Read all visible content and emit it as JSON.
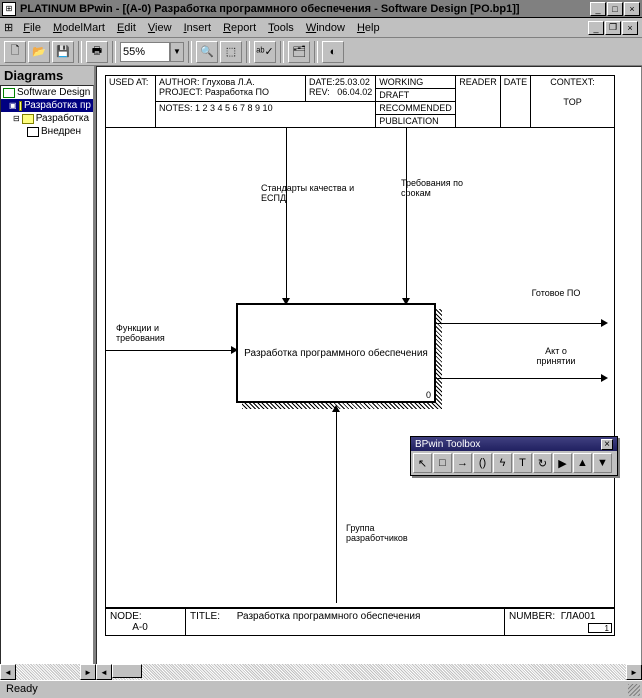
{
  "titlebar": {
    "text": "PLATINUM BPwin - [(A-0) Разработка программного  обеспечения - Software Design  [PO.bp1]]"
  },
  "menu": {
    "items": [
      "File",
      "ModelMart",
      "Edit",
      "View",
      "Insert",
      "Report",
      "Tools",
      "Window",
      "Help"
    ]
  },
  "toolbar": {
    "zoom": "55%"
  },
  "sidebar": {
    "title": "Diagrams",
    "items": [
      {
        "label": "Software Design",
        "icon": "root"
      },
      {
        "label": "Разработка пр",
        "icon": "diag",
        "sel": true,
        "indent": 8
      },
      {
        "label": "Разработка",
        "icon": "diag",
        "indent": 12
      },
      {
        "label": "Внедрен",
        "icon": "page",
        "indent": 26
      }
    ]
  },
  "header": {
    "used_at_label": "USED AT:",
    "author_label": "AUTHOR:",
    "author": "Глухова Л.А.",
    "project_label": "PROJECT:",
    "project": "Разработка ПО",
    "date_label": "DATE:",
    "date": "25.03.02",
    "rev_label": "REV:",
    "rev": "06.04.02",
    "working": "WORKING",
    "draft": "DRAFT",
    "recommended": "RECOMMENDED",
    "publication": "PUBLICATION",
    "reader": "READER",
    "date2": "DATE",
    "context": "CONTEXT:",
    "top": "TOP",
    "notes": "NOTES:  1  2  3  4  5  6  7  8  9 10"
  },
  "diagram": {
    "main_box": "Разработка программного  обеспечения",
    "box_num": "0",
    "input": "Функции и требования",
    "control1": "Стандарты качества и ЕСПД",
    "control2": "Требования по срокам",
    "output1": "Готовое ПО",
    "output2": "Акт о принятии",
    "mechanism": "Группа разработчиков"
  },
  "footer": {
    "node_label": "NODE:",
    "node": "A-0",
    "title_label": "TITLE:",
    "title": "Разработка программного  обеспечения",
    "number_label": "NUMBER:",
    "number": "ГЛА001",
    "page": "1"
  },
  "toolbox": {
    "title": "BPwin Toolbox",
    "buttons": [
      "↖",
      "□",
      "→",
      "()",
      "ϟ",
      "T",
      "↻",
      "▶",
      "▲",
      "▼"
    ]
  },
  "status": {
    "text": "Ready"
  }
}
